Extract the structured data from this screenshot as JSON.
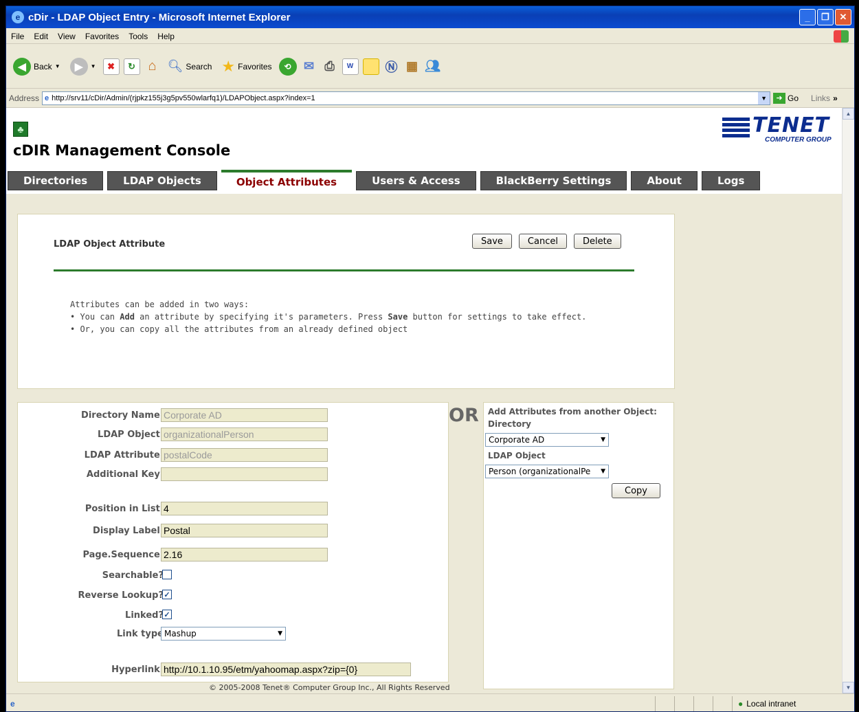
{
  "window": {
    "title": "cDir - LDAP Object Entry - Microsoft Internet Explorer"
  },
  "menu": [
    "File",
    "Edit",
    "View",
    "Favorites",
    "Tools",
    "Help"
  ],
  "toolbar": {
    "back": "Back",
    "search": "Search",
    "favorites": "Favorites"
  },
  "address": {
    "label": "Address",
    "url": "http://srv11/cDir/Admin/(rjpkz155j3g5pv550wlarfq1)/LDAPObject.aspx?index=1",
    "go": "Go",
    "links": "Links"
  },
  "page": {
    "title": "cDIR Management Console",
    "brand": "TENET",
    "brand_sub": "COMPUTER GROUP",
    "tabs": [
      "Directories",
      "LDAP Objects",
      "Object Attributes",
      "Users & Access",
      "BlackBerry Settings",
      "About",
      "Logs"
    ],
    "active_tab": "Object Attributes"
  },
  "attribute_panel": {
    "title": "LDAP Object Attribute",
    "save": "Save",
    "cancel": "Cancel",
    "delete": "Delete",
    "intro": "Attributes can be added in two ways:",
    "bullet1_pre": "You can ",
    "bullet1_add": "Add",
    "bullet1_mid": " an attribute by specifying it's parameters. Press ",
    "bullet1_save": "Save",
    "bullet1_post": " button for settings to take effect.",
    "bullet2": "Or, you can copy all the attributes from an already defined object"
  },
  "form": {
    "directory_name_label": "Directory Name:",
    "directory_name": "Corporate AD",
    "ldap_object_label": "LDAP Object:",
    "ldap_object": "organizationalPerson",
    "ldap_attribute_label": "LDAP Attribute:",
    "ldap_attribute": "postalCode",
    "additional_key_label": "Additional Key:",
    "additional_key": "",
    "position_label": "Position in List:",
    "position": "4",
    "display_label_label": "Display Label:",
    "display_label": "Postal",
    "page_sequence_label": "Page.Sequence:",
    "page_sequence": "2.16",
    "searchable_label": "Searchable?",
    "searchable": false,
    "reverse_lookup_label": "Reverse Lookup?",
    "reverse_lookup": true,
    "linked_label": "Linked?",
    "linked": true,
    "link_type_label": "Link type",
    "link_type": "Mashup",
    "hyperlink_label": "Hyperlink:",
    "hyperlink": "http://10.1.10.95/etm/yahoomap.aspx?zip={0}"
  },
  "copy_panel": {
    "or": "OR",
    "title": "Add Attributes from another Object:",
    "directory_label": "Directory",
    "directory": "Corporate AD",
    "ldap_object_label": "LDAP Object",
    "ldap_object": "Person (organizationalPe",
    "copy": "Copy"
  },
  "footer": "© 2005-2008 Tenet® Computer Group Inc., All Rights Reserved",
  "status": {
    "zone": "Local intranet"
  }
}
